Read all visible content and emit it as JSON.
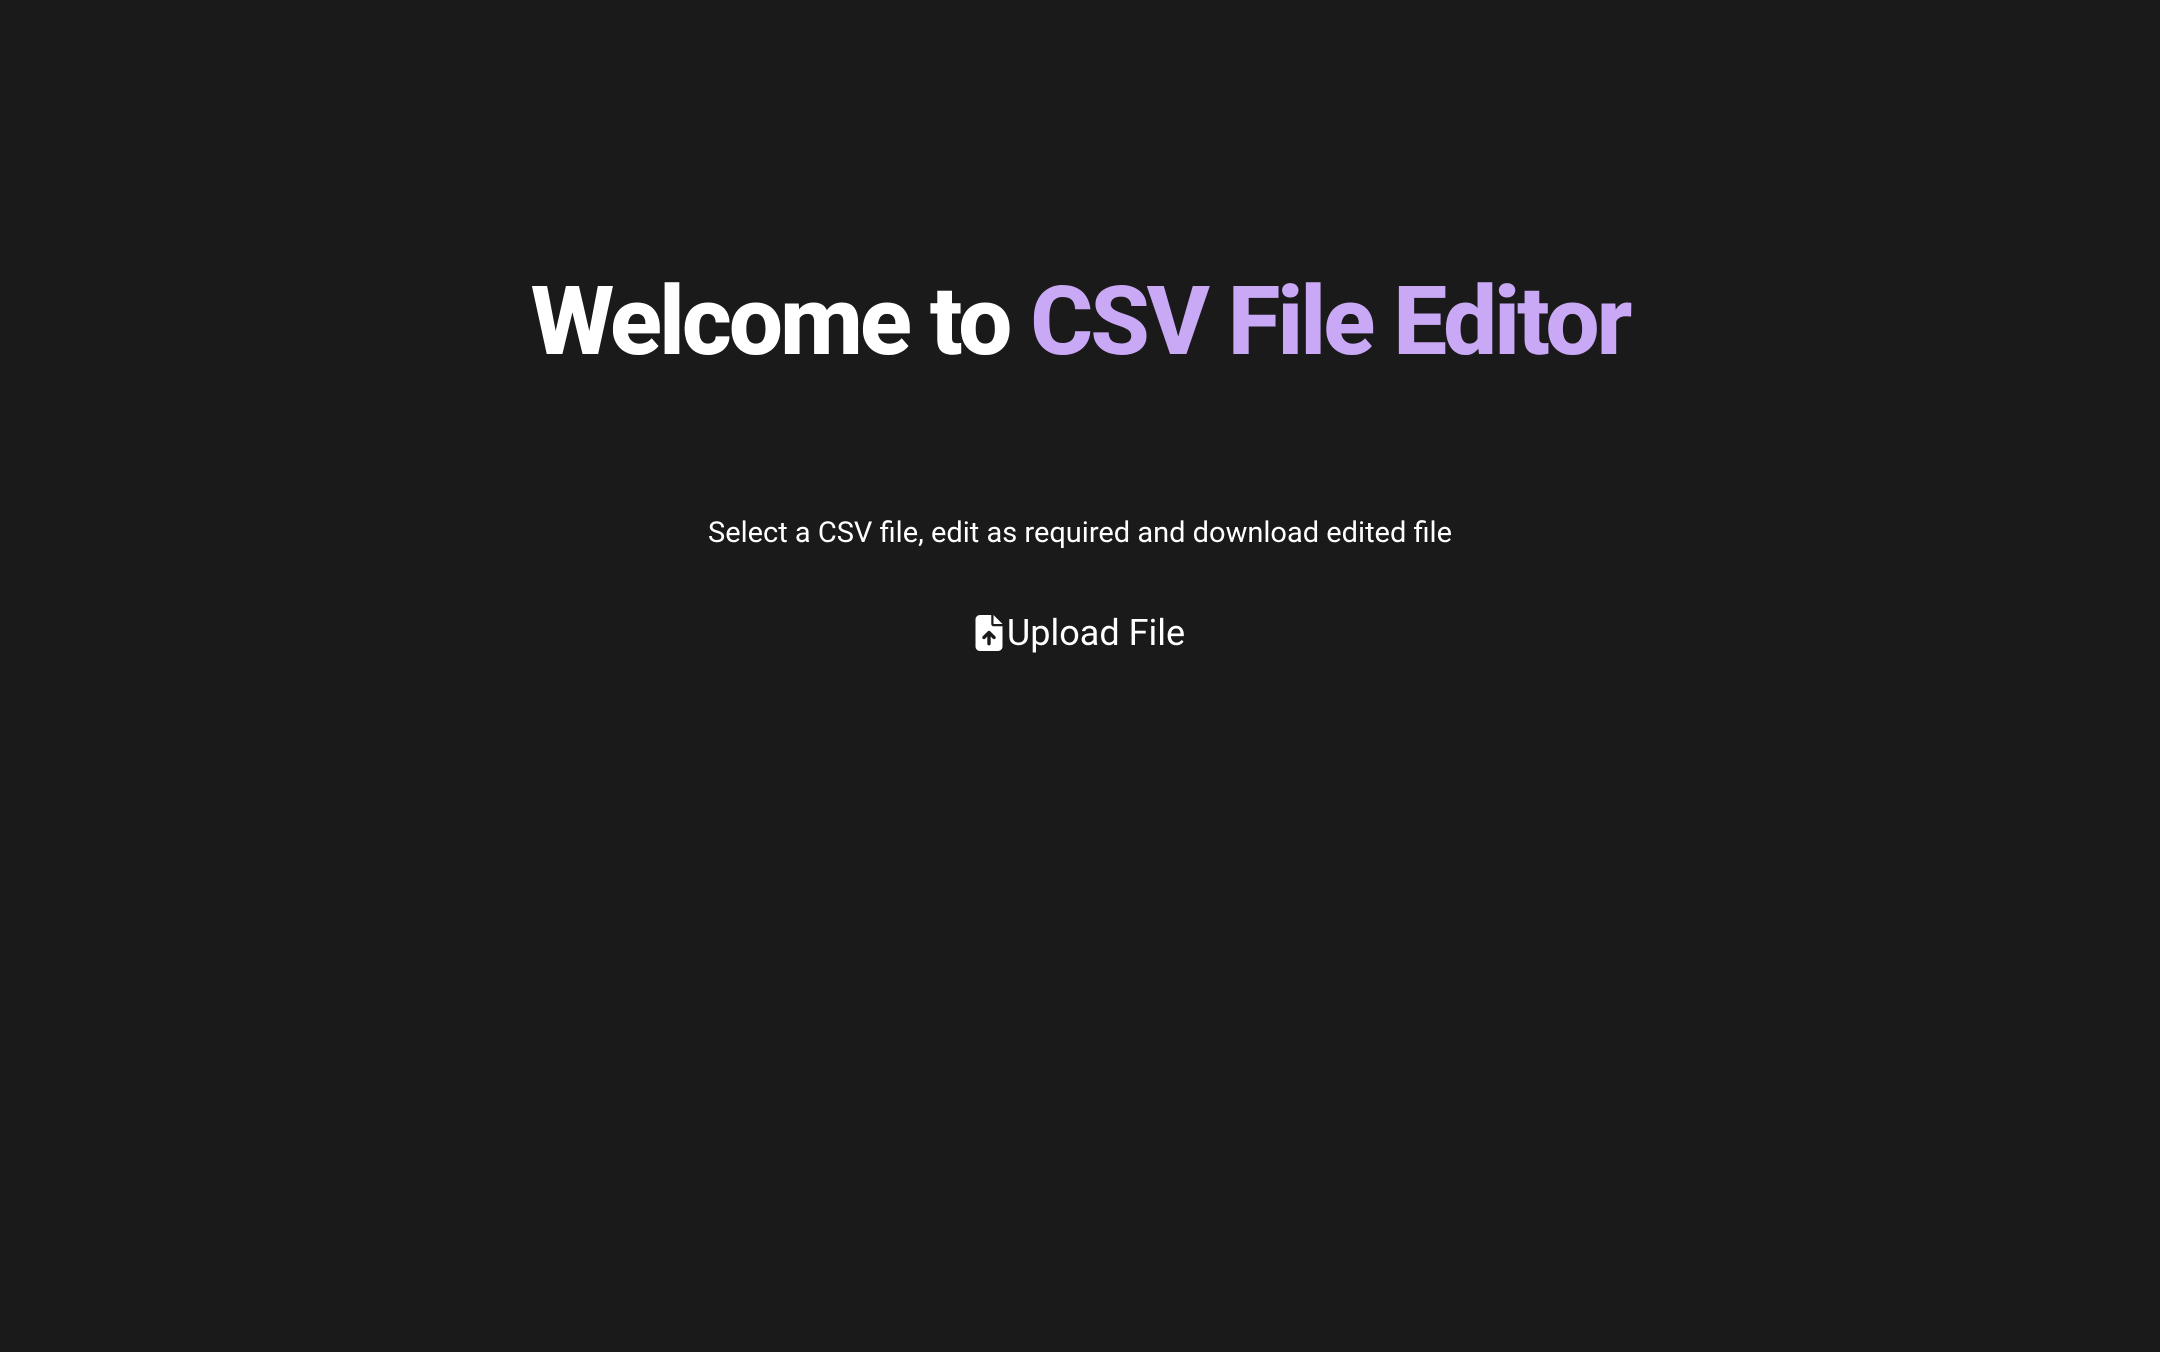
{
  "heading": {
    "prefix": "Welcome to ",
    "accent": "CSV File Editor"
  },
  "subtitle": "Select a CSV file, edit as required and download edited file",
  "upload": {
    "label": "Upload File"
  }
}
